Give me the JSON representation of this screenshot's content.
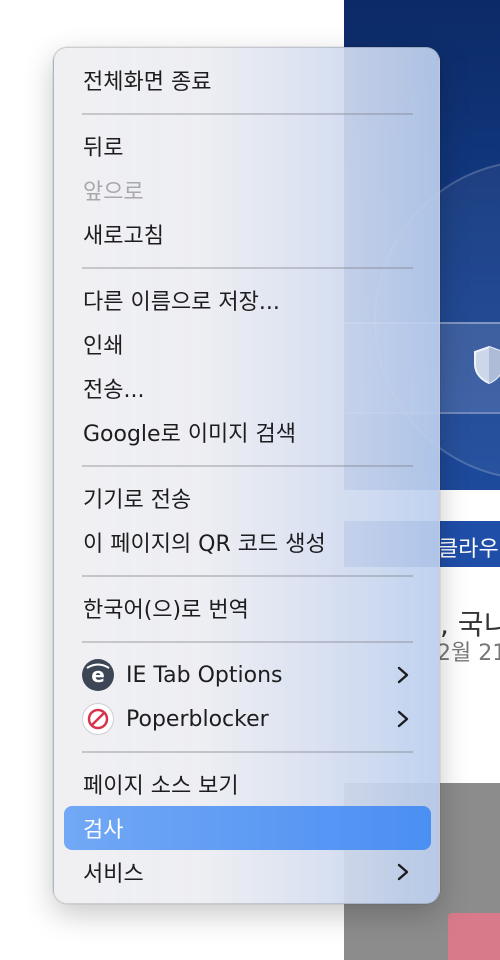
{
  "background_page": {
    "banner_text": "클라우",
    "headline": ", 국니",
    "date": "2월 21"
  },
  "context_menu": {
    "items": [
      {
        "id": "exit_fullscreen",
        "label": "전체화면 종료",
        "enabled": true
      },
      {
        "id": "back",
        "label": "뒤로",
        "enabled": true
      },
      {
        "id": "forward",
        "label": "앞으로",
        "enabled": false
      },
      {
        "id": "reload",
        "label": "새로고침",
        "enabled": true
      },
      {
        "id": "save_as",
        "label": "다른 이름으로 저장...",
        "enabled": true
      },
      {
        "id": "print",
        "label": "인쇄",
        "enabled": true
      },
      {
        "id": "send",
        "label": "전송...",
        "enabled": true
      },
      {
        "id": "google_image_search",
        "label": "Google로 이미지 검색",
        "enabled": true
      },
      {
        "id": "send_to_device",
        "label": "기기로 전송",
        "enabled": true
      },
      {
        "id": "qr_code",
        "label": "이 페이지의 QR 코드 생성",
        "enabled": true
      },
      {
        "id": "translate",
        "label": "한국어(으)로 번역",
        "enabled": true
      },
      {
        "id": "ie_tab",
        "label": "IE Tab Options",
        "enabled": true,
        "icon": "ie-tab-icon",
        "submenu": true
      },
      {
        "id": "poperblocker",
        "label": "Poperblocker",
        "enabled": true,
        "icon": "poperblocker-icon",
        "submenu": true
      },
      {
        "id": "view_source",
        "label": "페이지 소스 보기",
        "enabled": true
      },
      {
        "id": "inspect",
        "label": "검사",
        "enabled": true,
        "selected": true
      },
      {
        "id": "services",
        "label": "서비스",
        "enabled": true,
        "submenu": true
      }
    ],
    "colors": {
      "highlight": "#4b8ff3",
      "disabled_text": "#a9a9ad",
      "text": "#1d1d1f"
    }
  }
}
